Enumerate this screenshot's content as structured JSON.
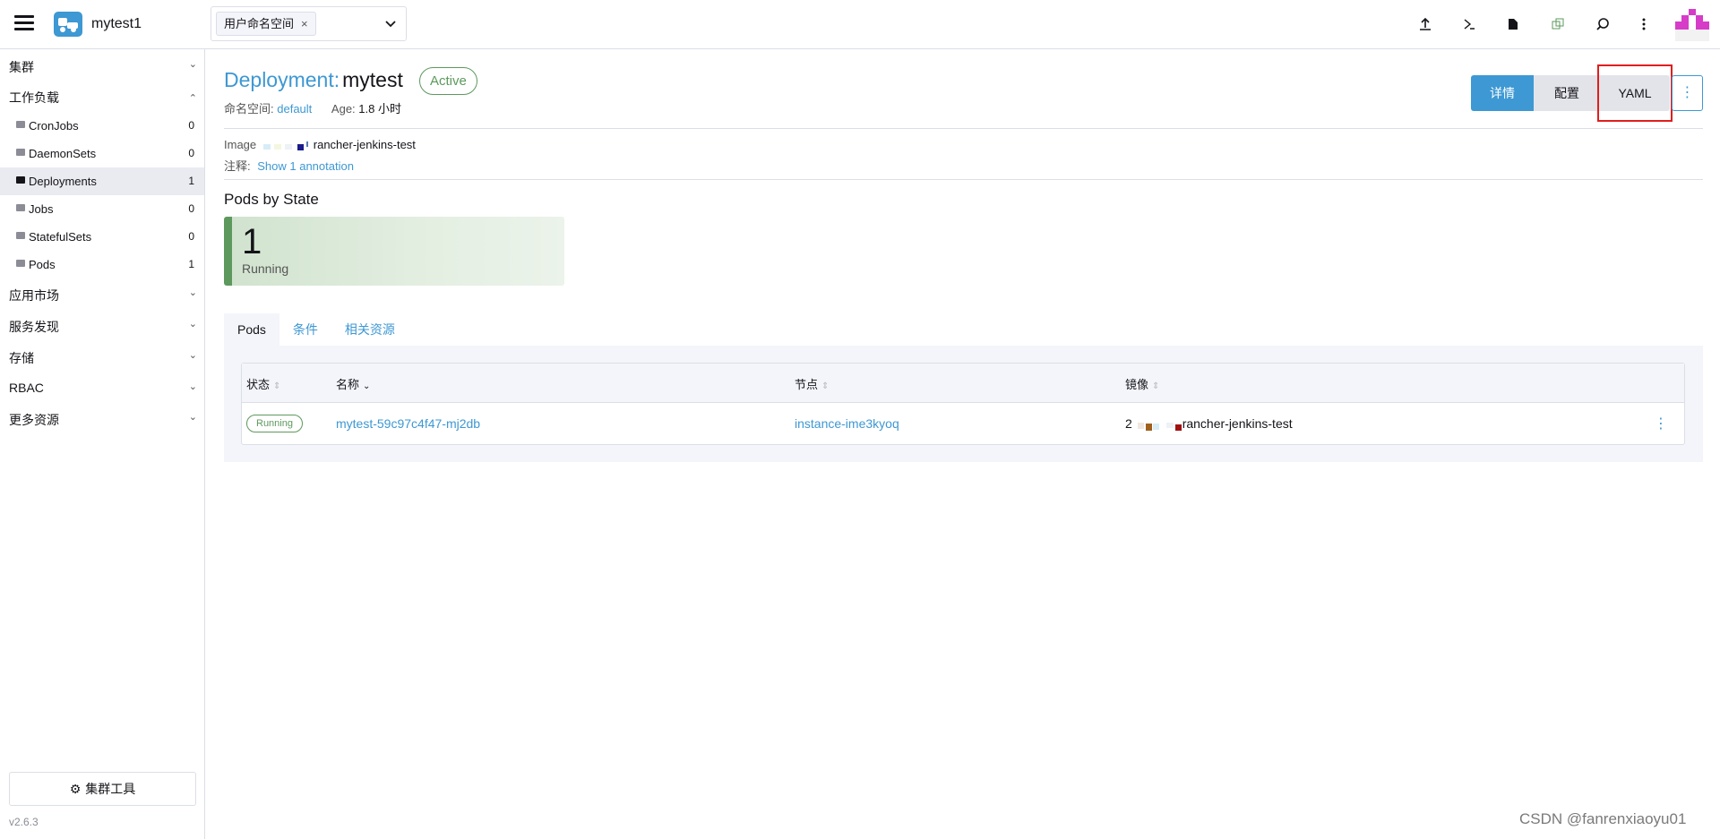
{
  "header": {
    "cluster_name": "mytest1",
    "namespace_chip": "用户命名空间",
    "namespace_chip_remove": "×",
    "icons": [
      "upload-icon",
      "shell-icon",
      "file-icon",
      "copy-icon",
      "search-icon",
      "more-vertical-icon"
    ]
  },
  "sidebar": {
    "groups": {
      "cluster": "集群",
      "workloads": "工作负载",
      "apps": "应用市场",
      "service_discovery": "服务发现",
      "storage": "存储",
      "rbac": "RBAC",
      "more": "更多资源"
    },
    "items": [
      {
        "label": "CronJobs",
        "count": "0"
      },
      {
        "label": "DaemonSets",
        "count": "0"
      },
      {
        "label": "Deployments",
        "count": "1"
      },
      {
        "label": "Jobs",
        "count": "0"
      },
      {
        "label": "StatefulSets",
        "count": "0"
      },
      {
        "label": "Pods",
        "count": "1"
      }
    ],
    "tools_button": "集群工具",
    "version": "v2.6.3"
  },
  "detail": {
    "type": "Deployment:",
    "name": "mytest",
    "status": "Active",
    "namespace_label": "命名空间:",
    "namespace_value": "default",
    "age_label": "Age:",
    "age_value": "1.8 小时",
    "buttons": {
      "detail": "详情",
      "config": "配置",
      "yaml": "YAML",
      "more": "⋮"
    },
    "image_label": "Image",
    "image_value": "rancher-jenkins-test",
    "annotation_label": "注释:",
    "annotation_link": "Show 1 annotation"
  },
  "pods_by_state": {
    "heading": "Pods by State",
    "count": "1",
    "state": "Running"
  },
  "tabs": [
    "Pods",
    "条件",
    "相关资源"
  ],
  "table": {
    "headers": {
      "status": "状态",
      "name": "名称",
      "node": "节点",
      "image": "镜像"
    },
    "rows": [
      {
        "status": "Running",
        "name": "mytest-59c97c4f47-mj2db",
        "node": "instance-ime3kyoq",
        "image_prefix": "2",
        "image": "rancher-jenkins-test"
      }
    ]
  },
  "watermark": "CSDN @fanrenxiaoyu01"
}
